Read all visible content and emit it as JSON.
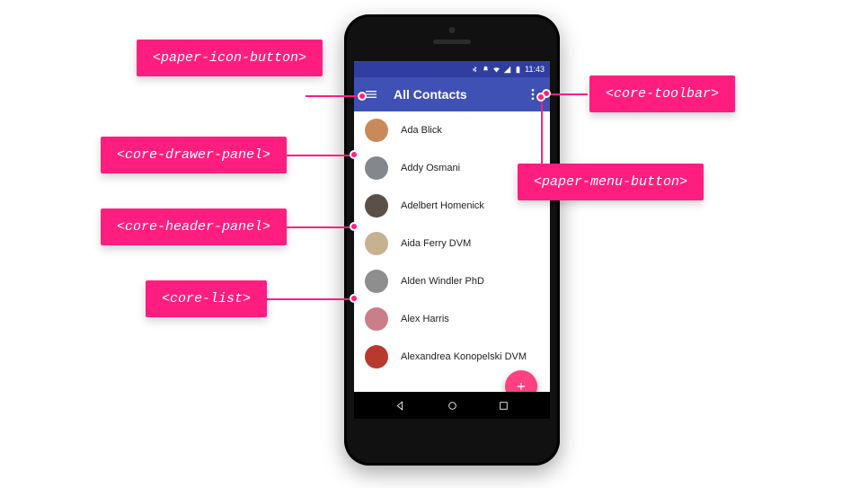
{
  "statusbar": {
    "time": "11:43",
    "icons": [
      "bluetooth",
      "silent",
      "wifi",
      "signal",
      "battery"
    ]
  },
  "toolbar": {
    "menu_icon": "menu",
    "title": "All Contacts",
    "overflow_icon": "more-vert"
  },
  "contacts": [
    {
      "name": "Ada Blick",
      "avatar_color": "#c98a5a"
    },
    {
      "name": "Addy Osmani",
      "avatar_color": "#84888c"
    },
    {
      "name": "Adelbert Homenick",
      "avatar_color": "#5b4f47"
    },
    {
      "name": "Aida Ferry DVM",
      "avatar_color": "#c6b191"
    },
    {
      "name": "Alden Windler PhD",
      "avatar_color": "#8e8e8e"
    },
    {
      "name": "Alex Harris",
      "avatar_color": "#c97e8a"
    },
    {
      "name": "Alexandrea Konopelski DVM",
      "avatar_color": "#b83a2e"
    }
  ],
  "fab": {
    "icon": "add"
  },
  "callouts": {
    "paper_icon_button": "<paper-icon-button>",
    "core_drawer_panel": "<core-drawer-panel>",
    "core_header_panel": "<core-header-panel>",
    "core_list": "<core-list>",
    "core_toolbar": "<core-toolbar>",
    "paper_menu_button": "<paper-menu-button>"
  },
  "colors": {
    "brand": "#3f51b5",
    "brand_dark": "#303f9f",
    "accent": "#ff4081",
    "callout": "#ff1e7f"
  }
}
